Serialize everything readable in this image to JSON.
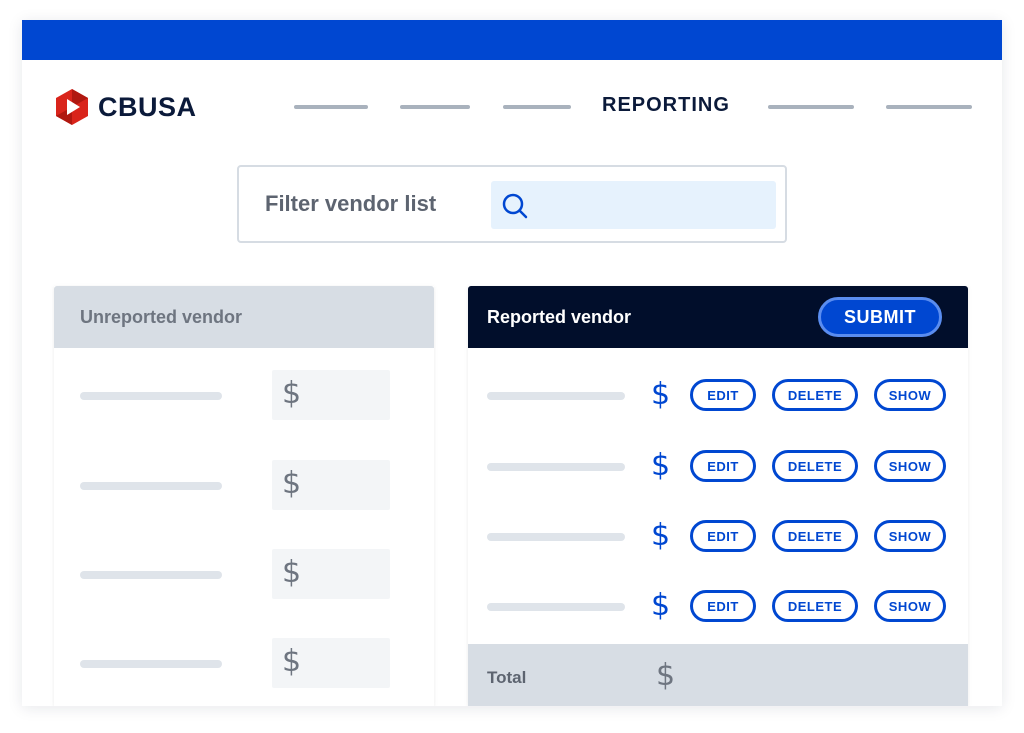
{
  "brand": {
    "name": "CBUSA",
    "accent_color": "#0047d1",
    "logo_color": "#d9241b"
  },
  "nav": {
    "active_item": "REPORTING"
  },
  "filter": {
    "label": "Filter vendor list",
    "icon": "search-icon",
    "value": ""
  },
  "unreported": {
    "title": "Unreported vendor",
    "rows": [
      {
        "amount": "$"
      },
      {
        "amount": "$"
      },
      {
        "amount": "$"
      },
      {
        "amount": "$"
      }
    ]
  },
  "reported": {
    "title": "Reported vendor",
    "submit_label": "SUBMIT",
    "rows": [
      {
        "amount": "$",
        "edit": "EDIT",
        "delete": "DELETE",
        "show": "SHOW"
      },
      {
        "amount": "$",
        "edit": "EDIT",
        "delete": "DELETE",
        "show": "SHOW"
      },
      {
        "amount": "$",
        "edit": "EDIT",
        "delete": "DELETE",
        "show": "SHOW"
      },
      {
        "amount": "$",
        "edit": "EDIT",
        "delete": "DELETE",
        "show": "SHOW"
      }
    ],
    "total_label": "Total",
    "total_amount": "$"
  }
}
